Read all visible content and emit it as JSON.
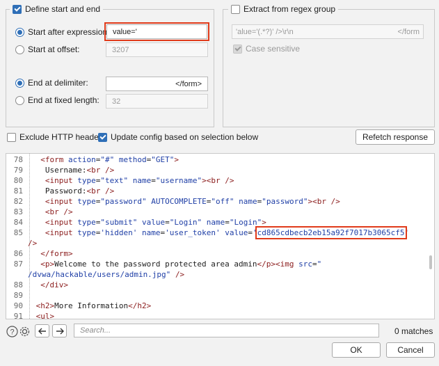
{
  "left_group": {
    "legend": "Define start and end",
    "start_after": {
      "label": "Start after expression:",
      "value": "value='"
    },
    "start_offset": {
      "label": "Start at offset:",
      "value": "3207"
    },
    "end_delim": {
      "label": "End at delimiter:",
      "value": "</form>"
    },
    "end_fixed": {
      "label": "End at fixed length:",
      "value": "32"
    }
  },
  "right_group": {
    "legend": "Extract from regex group",
    "regex_value": "'alue='(.*?)' />\\r\\n",
    "regex_suffix": "</form",
    "case_sensitive": "Case sensitive"
  },
  "options": {
    "exclude_headers": "Exclude HTTP headers",
    "update_config": "Update config based on selection below",
    "refetch": "Refetch response"
  },
  "code_lines": [
    {
      "n": "78",
      "parts": [
        [
          "p",
          "  "
        ],
        [
          "t",
          "<form"
        ],
        [
          "p",
          " "
        ],
        [
          "a",
          "action"
        ],
        [
          "p",
          "="
        ],
        [
          "v",
          "\"#\""
        ],
        [
          "p",
          " "
        ],
        [
          "a",
          "method"
        ],
        [
          "p",
          "="
        ],
        [
          "v",
          "\"GET\""
        ],
        [
          "t",
          ">"
        ]
      ]
    },
    {
      "n": "79",
      "parts": [
        [
          "p",
          "   Username:"
        ],
        [
          "t",
          "<br"
        ],
        [
          "p",
          " "
        ],
        [
          "t",
          "/>"
        ]
      ]
    },
    {
      "n": "80",
      "parts": [
        [
          "p",
          "   "
        ],
        [
          "t",
          "<input"
        ],
        [
          "p",
          " "
        ],
        [
          "a",
          "type"
        ],
        [
          "p",
          "="
        ],
        [
          "v",
          "\"text\""
        ],
        [
          "p",
          " "
        ],
        [
          "a",
          "name"
        ],
        [
          "p",
          "="
        ],
        [
          "v",
          "\"username\""
        ],
        [
          "t",
          ">"
        ],
        [
          "t",
          "<br"
        ],
        [
          "p",
          " "
        ],
        [
          "t",
          "/>"
        ]
      ]
    },
    {
      "n": "81",
      "parts": [
        [
          "p",
          "   Password:"
        ],
        [
          "t",
          "<br"
        ],
        [
          "p",
          " "
        ],
        [
          "t",
          "/>"
        ]
      ]
    },
    {
      "n": "82",
      "parts": [
        [
          "p",
          "   "
        ],
        [
          "t",
          "<input"
        ],
        [
          "p",
          " "
        ],
        [
          "a",
          "type"
        ],
        [
          "p",
          "="
        ],
        [
          "v",
          "\"password\""
        ],
        [
          "p",
          " "
        ],
        [
          "a",
          "AUTOCOMPLETE"
        ],
        [
          "p",
          "="
        ],
        [
          "v",
          "\"off\""
        ],
        [
          "p",
          " "
        ],
        [
          "a",
          "name"
        ],
        [
          "p",
          "="
        ],
        [
          "v",
          "\"password\""
        ],
        [
          "t",
          ">"
        ],
        [
          "t",
          "<br"
        ],
        [
          "p",
          " "
        ],
        [
          "t",
          "/>"
        ]
      ]
    },
    {
      "n": "83",
      "parts": [
        [
          "p",
          "   "
        ],
        [
          "t",
          "<br"
        ],
        [
          "p",
          " "
        ],
        [
          "t",
          "/>"
        ]
      ]
    },
    {
      "n": "84",
      "parts": [
        [
          "p",
          "   "
        ],
        [
          "t",
          "<input"
        ],
        [
          "p",
          " "
        ],
        [
          "a",
          "type"
        ],
        [
          "p",
          "="
        ],
        [
          "v",
          "\"submit\""
        ],
        [
          "p",
          " "
        ],
        [
          "a",
          "value"
        ],
        [
          "p",
          "="
        ],
        [
          "v",
          "\"Login\""
        ],
        [
          "p",
          " "
        ],
        [
          "a",
          "name"
        ],
        [
          "p",
          "="
        ],
        [
          "v",
          "\"Login\""
        ],
        [
          "t",
          ">"
        ]
      ]
    },
    {
      "n": "85",
      "parts": [
        [
          "p",
          "   "
        ],
        [
          "t",
          "<input"
        ],
        [
          "p",
          " "
        ],
        [
          "a",
          "type"
        ],
        [
          "p",
          "="
        ],
        [
          "v",
          "'hidden'"
        ],
        [
          "p",
          " "
        ],
        [
          "a",
          "name"
        ],
        [
          "p",
          "="
        ],
        [
          "v",
          "'user_token'"
        ],
        [
          "p",
          " "
        ],
        [
          "a",
          "value"
        ],
        [
          "p",
          "="
        ],
        [
          "v",
          "'"
        ],
        [
          "s",
          "cd865cdbecb2eb15a92f7017b3065cf5"
        ],
        [
          "v",
          "'"
        ]
      ]
    },
    {
      "n": "",
      "parts": [
        [
          "t",
          "/>"
        ]
      ]
    },
    {
      "n": "86",
      "parts": [
        [
          "p",
          "  "
        ],
        [
          "t",
          "</form>"
        ]
      ]
    },
    {
      "n": "87",
      "parts": [
        [
          "p",
          "  "
        ],
        [
          "t",
          "<p>"
        ],
        [
          "p",
          "Welcome to the password protected area admin"
        ],
        [
          "t",
          "</p>"
        ],
        [
          "t",
          "<img"
        ],
        [
          "p",
          " "
        ],
        [
          "a",
          "src"
        ],
        [
          "p",
          "="
        ],
        [
          "v",
          "\""
        ]
      ]
    },
    {
      "n": "",
      "parts": [
        [
          "v",
          "/dvwa/hackable/users/admin.jpg\""
        ],
        [
          "p",
          " "
        ],
        [
          "t",
          "/>"
        ]
      ]
    },
    {
      "n": "88",
      "parts": [
        [
          "p",
          "  "
        ],
        [
          "t",
          "</div>"
        ]
      ]
    },
    {
      "n": "89",
      "parts": []
    },
    {
      "n": "90",
      "parts": [
        [
          "p",
          " "
        ],
        [
          "t",
          "<h2>"
        ],
        [
          "p",
          "More Information"
        ],
        [
          "t",
          "</h2>"
        ]
      ]
    },
    {
      "n": "91",
      "parts": [
        [
          "p",
          " "
        ],
        [
          "t",
          "<ul>"
        ]
      ]
    }
  ],
  "search": {
    "placeholder": "Search...",
    "matches": "0 matches"
  },
  "footer": {
    "ok": "OK",
    "cancel": "Cancel"
  },
  "colors": {
    "accent": "#2f6fb7",
    "highlight": "#e03a1a",
    "tag": "#8b1c1c",
    "attr": "#1f3fa6"
  }
}
